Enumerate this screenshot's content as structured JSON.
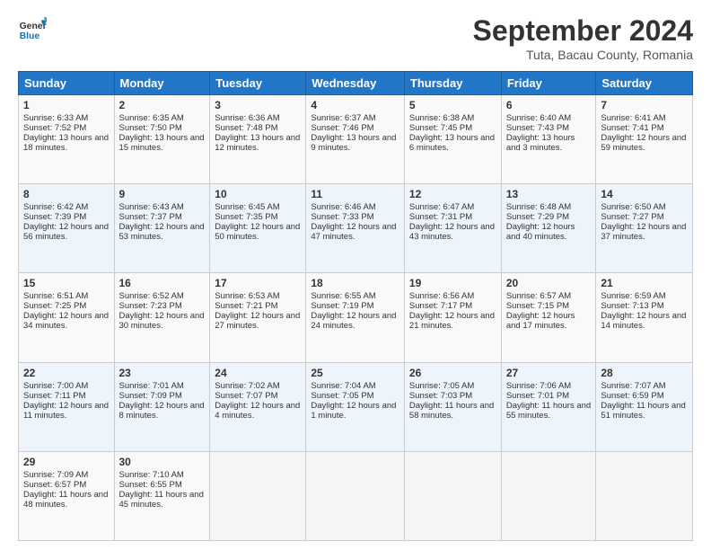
{
  "logo": {
    "line1": "General",
    "line2": "Blue"
  },
  "title": "September 2024",
  "location": "Tuta, Bacau County, Romania",
  "headers": [
    "Sunday",
    "Monday",
    "Tuesday",
    "Wednesday",
    "Thursday",
    "Friday",
    "Saturday"
  ],
  "weeks": [
    [
      {
        "day": "1",
        "sunrise": "6:33 AM",
        "sunset": "7:52 PM",
        "daylight": "13 hours and 18 minutes."
      },
      {
        "day": "2",
        "sunrise": "6:35 AM",
        "sunset": "7:50 PM",
        "daylight": "13 hours and 15 minutes."
      },
      {
        "day": "3",
        "sunrise": "6:36 AM",
        "sunset": "7:48 PM",
        "daylight": "13 hours and 12 minutes."
      },
      {
        "day": "4",
        "sunrise": "6:37 AM",
        "sunset": "7:46 PM",
        "daylight": "13 hours and 9 minutes."
      },
      {
        "day": "5",
        "sunrise": "6:38 AM",
        "sunset": "7:45 PM",
        "daylight": "13 hours and 6 minutes."
      },
      {
        "day": "6",
        "sunrise": "6:40 AM",
        "sunset": "7:43 PM",
        "daylight": "13 hours and 3 minutes."
      },
      {
        "day": "7",
        "sunrise": "6:41 AM",
        "sunset": "7:41 PM",
        "daylight": "12 hours and 59 minutes."
      }
    ],
    [
      {
        "day": "8",
        "sunrise": "6:42 AM",
        "sunset": "7:39 PM",
        "daylight": "12 hours and 56 minutes."
      },
      {
        "day": "9",
        "sunrise": "6:43 AM",
        "sunset": "7:37 PM",
        "daylight": "12 hours and 53 minutes."
      },
      {
        "day": "10",
        "sunrise": "6:45 AM",
        "sunset": "7:35 PM",
        "daylight": "12 hours and 50 minutes."
      },
      {
        "day": "11",
        "sunrise": "6:46 AM",
        "sunset": "7:33 PM",
        "daylight": "12 hours and 47 minutes."
      },
      {
        "day": "12",
        "sunrise": "6:47 AM",
        "sunset": "7:31 PM",
        "daylight": "12 hours and 43 minutes."
      },
      {
        "day": "13",
        "sunrise": "6:48 AM",
        "sunset": "7:29 PM",
        "daylight": "12 hours and 40 minutes."
      },
      {
        "day": "14",
        "sunrise": "6:50 AM",
        "sunset": "7:27 PM",
        "daylight": "12 hours and 37 minutes."
      }
    ],
    [
      {
        "day": "15",
        "sunrise": "6:51 AM",
        "sunset": "7:25 PM",
        "daylight": "12 hours and 34 minutes."
      },
      {
        "day": "16",
        "sunrise": "6:52 AM",
        "sunset": "7:23 PM",
        "daylight": "12 hours and 30 minutes."
      },
      {
        "day": "17",
        "sunrise": "6:53 AM",
        "sunset": "7:21 PM",
        "daylight": "12 hours and 27 minutes."
      },
      {
        "day": "18",
        "sunrise": "6:55 AM",
        "sunset": "7:19 PM",
        "daylight": "12 hours and 24 minutes."
      },
      {
        "day": "19",
        "sunrise": "6:56 AM",
        "sunset": "7:17 PM",
        "daylight": "12 hours and 21 minutes."
      },
      {
        "day": "20",
        "sunrise": "6:57 AM",
        "sunset": "7:15 PM",
        "daylight": "12 hours and 17 minutes."
      },
      {
        "day": "21",
        "sunrise": "6:59 AM",
        "sunset": "7:13 PM",
        "daylight": "12 hours and 14 minutes."
      }
    ],
    [
      {
        "day": "22",
        "sunrise": "7:00 AM",
        "sunset": "7:11 PM",
        "daylight": "12 hours and 11 minutes."
      },
      {
        "day": "23",
        "sunrise": "7:01 AM",
        "sunset": "7:09 PM",
        "daylight": "12 hours and 8 minutes."
      },
      {
        "day": "24",
        "sunrise": "7:02 AM",
        "sunset": "7:07 PM",
        "daylight": "12 hours and 4 minutes."
      },
      {
        "day": "25",
        "sunrise": "7:04 AM",
        "sunset": "7:05 PM",
        "daylight": "12 hours and 1 minute."
      },
      {
        "day": "26",
        "sunrise": "7:05 AM",
        "sunset": "7:03 PM",
        "daylight": "11 hours and 58 minutes."
      },
      {
        "day": "27",
        "sunrise": "7:06 AM",
        "sunset": "7:01 PM",
        "daylight": "11 hours and 55 minutes."
      },
      {
        "day": "28",
        "sunrise": "7:07 AM",
        "sunset": "6:59 PM",
        "daylight": "11 hours and 51 minutes."
      }
    ],
    [
      {
        "day": "29",
        "sunrise": "7:09 AM",
        "sunset": "6:57 PM",
        "daylight": "11 hours and 48 minutes."
      },
      {
        "day": "30",
        "sunrise": "7:10 AM",
        "sunset": "6:55 PM",
        "daylight": "11 hours and 45 minutes."
      },
      null,
      null,
      null,
      null,
      null
    ]
  ]
}
